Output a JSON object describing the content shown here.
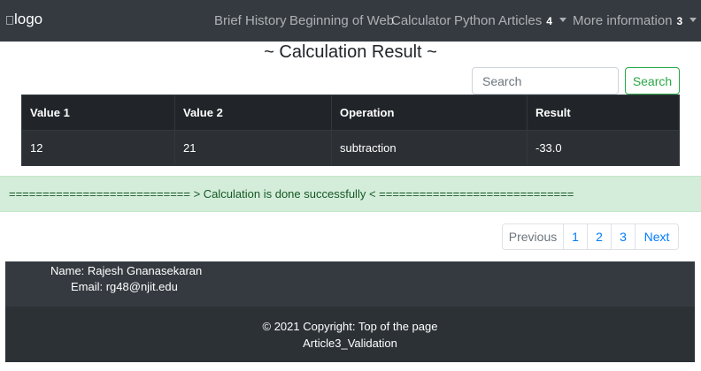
{
  "navbar": {
    "logo_alt": "logo",
    "items": [
      {
        "label": "Brief History"
      },
      {
        "label": "Beginning of Web"
      },
      {
        "label": "Calculator"
      },
      {
        "label": "Python Articles",
        "badge": "4"
      },
      {
        "label": "More information",
        "badge": "3"
      }
    ]
  },
  "page": {
    "title": "~ Calculation Result ~"
  },
  "search": {
    "placeholder": "Search",
    "button_label": "Search"
  },
  "table": {
    "headers": [
      "Value 1",
      "Value 2",
      "Operation",
      "Result"
    ],
    "rows": [
      [
        "12",
        "21",
        "subtraction",
        "-33.0"
      ]
    ]
  },
  "alert": {
    "message": "=========================== > Calculation is done successfully < ============================="
  },
  "pagination": {
    "previous": "Previous",
    "pages": [
      "1",
      "2",
      "3"
    ],
    "next": "Next"
  },
  "footer": {
    "name": "Name: Rajesh Gnanasekaran",
    "email": "Email: rg48@njit.edu",
    "copyright": "© 2021 Copyright: Top of the page",
    "article": "Article3_Validation"
  },
  "colors": {
    "navbar_bg": "#343a40",
    "table_bg": "#212529",
    "alert_bg": "#d4edda",
    "alert_text": "#155724",
    "link": "#007bff",
    "success": "#28a745"
  }
}
